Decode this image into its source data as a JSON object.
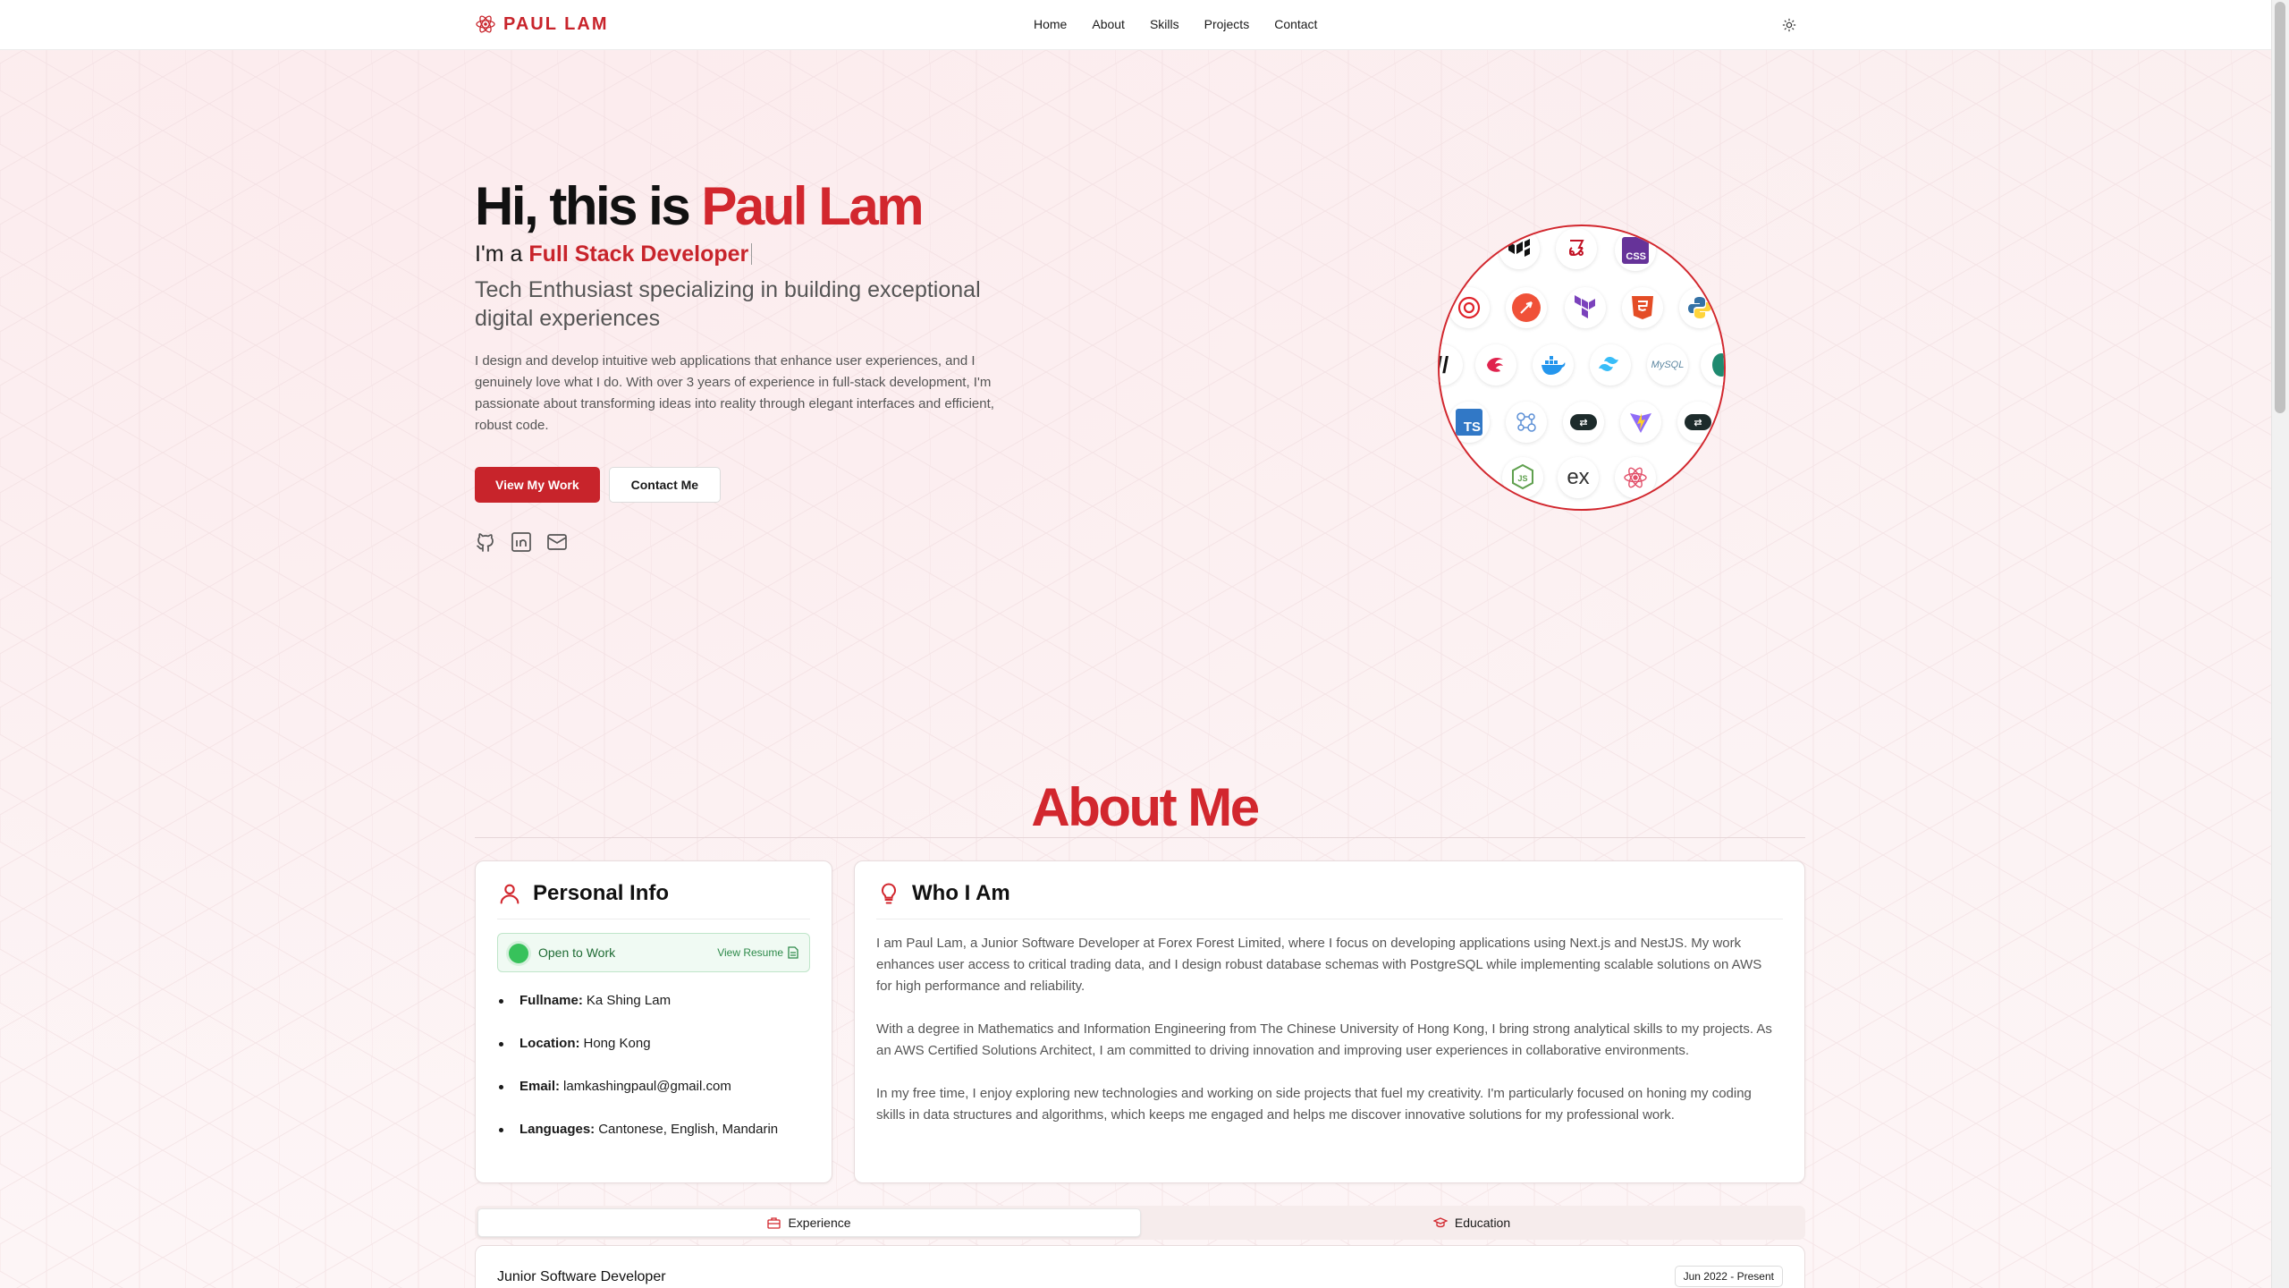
{
  "nav": {
    "logo_text": "PAUL LAM",
    "links": [
      "Home",
      "About",
      "Skills",
      "Projects",
      "Contact"
    ]
  },
  "hero": {
    "greeting": "Hi, this is ",
    "name": "Paul Lam",
    "role_prefix": "I'm a ",
    "role": "Full Stack Developer",
    "tagline": "Tech Enthusiast specializing in building exceptional digital experiences",
    "description": "I design and develop intuitive web applications that enhance user experiences, and I genuinely love what I do. With over 3 years of experience in full-stack development, I'm passionate about transforming ideas into reality through elegant interfaces and efficient, robust code.",
    "primary_button": "View My Work",
    "secondary_button": "Contact Me"
  },
  "skills_globe": {
    "labels": {
      "css": "CSS",
      "ts": "TS",
      "mysql": "MySQL",
      "ex": "ex",
      "js": "JS"
    }
  },
  "about": {
    "heading": "About Me",
    "personal": {
      "title": "Personal Info",
      "status": "Open to Work",
      "resume_link": "View Resume",
      "items": [
        {
          "key": "Fullname:",
          "value": "Ka Shing Lam"
        },
        {
          "key": "Location:",
          "value": "Hong Kong"
        },
        {
          "key": "Email:",
          "value": "lamkashingpaul@gmail.com"
        },
        {
          "key": "Languages:",
          "value": "Cantonese, English, Mandarin"
        }
      ]
    },
    "who": {
      "title": "Who I Am",
      "paragraphs": [
        "I am Paul Lam, a Junior Software Developer at Forex Forest Limited, where I focus on developing applications using Next.js and NestJS. My work enhances user access to critical trading data, and I design robust database schemas with PostgreSQL while implementing scalable solutions on AWS for high performance and reliability.",
        "With a degree in Mathematics and Information Engineering from The Chinese University of Hong Kong, I bring strong analytical skills to my projects. As an AWS Certified Solutions Architect, I am committed to driving innovation and improving user experiences in collaborative environments.",
        "In my free time, I enjoy exploring new technologies and working on side projects that fuel my creativity. I'm particularly focused on honing my coding skills in data structures and algorithms, which keeps me engaged and helps me discover innovative solutions for my professional work."
      ]
    }
  },
  "tabs": {
    "experience": "Experience",
    "education": "Education"
  },
  "experience": {
    "title": "Junior Software Developer",
    "date": "Jun 2022 - Present"
  },
  "colors": {
    "accent": "#d2272e",
    "status_green": "#37c25b"
  }
}
